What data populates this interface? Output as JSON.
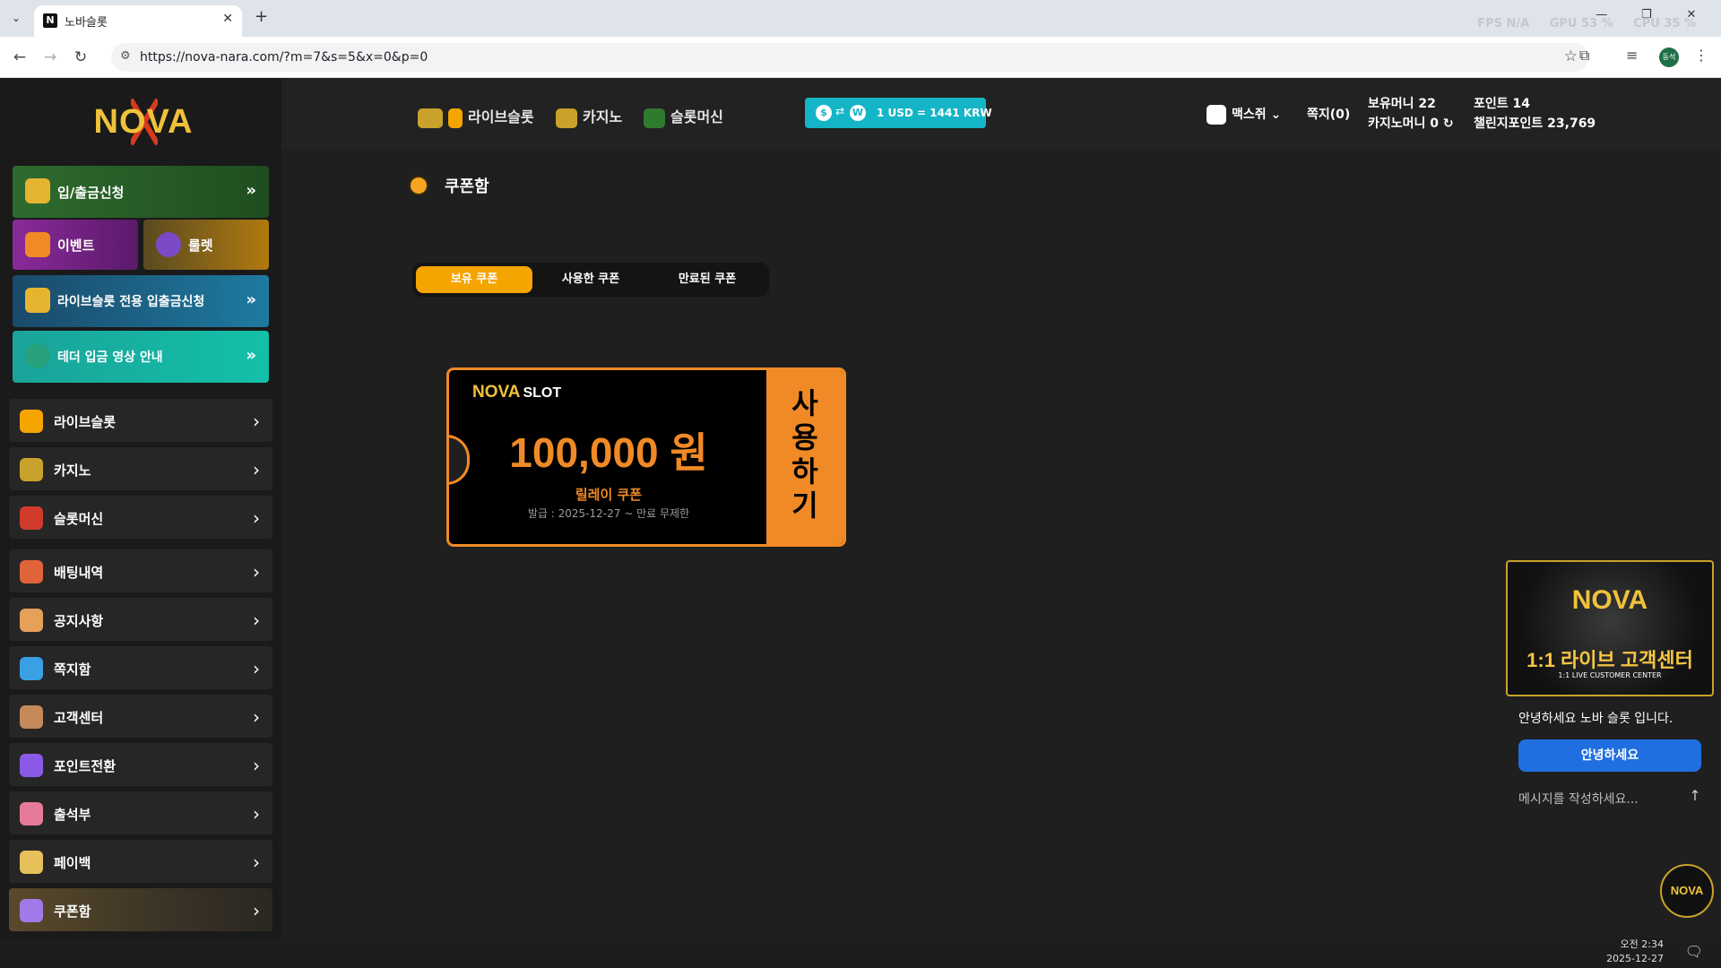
{
  "browser": {
    "tab_title": "노바슬롯",
    "tab_favicon": "N",
    "url": "https://nova-nara.com/?m=7&s=5&x=0&p=0",
    "perf": {
      "fps": "FPS  N/A",
      "gpu": "GPU  53 %",
      "cpu": "CPU  35 %"
    },
    "profile_initial": "동석"
  },
  "site": {
    "logo": "NOVA",
    "side_buttons": {
      "deposit": "입/출금신청",
      "event": "이벤트",
      "roulette": "룰렛",
      "liveslot_deposit": "라이브슬롯 전용 입출금신청",
      "tether_guide": "테더 입금 영상 안내"
    },
    "menu": [
      {
        "label": "라이브슬롯",
        "icon": "liveslot-icon",
        "color": "#f6a400"
      },
      {
        "label": "카지노",
        "icon": "casino-icon",
        "color": "#c9a22b"
      },
      {
        "label": "슬롯머신",
        "icon": "slot-machine-icon",
        "color": "#d03b2b"
      },
      {
        "label": "배팅내역",
        "icon": "clipboard-icon",
        "color": "#e0633a"
      },
      {
        "label": "공지사항",
        "icon": "megaphone-icon",
        "color": "#e6a05a"
      },
      {
        "label": "쪽지함",
        "icon": "chat-bubble-icon",
        "color": "#3aa0e6"
      },
      {
        "label": "고객센터",
        "icon": "support-agent-icon",
        "color": "#c48a5a"
      },
      {
        "label": "포인트전환",
        "icon": "exchange-icon",
        "color": "#8a5ae6"
      },
      {
        "label": "출석부",
        "icon": "calendar-icon",
        "color": "#e67a9a"
      },
      {
        "label": "페이백",
        "icon": "coin-icon",
        "color": "#e6c05a"
      },
      {
        "label": "쿠폰함",
        "icon": "ticket-icon",
        "color": "#a07ae6"
      }
    ],
    "topnav": {
      "liveslot": "라이브슬롯",
      "casino": "카지노",
      "slot": "슬롯머신",
      "rate_text": "1 USD = 1441 KRW",
      "rate_from": "$",
      "rate_to": "W",
      "username": "맥스쥐",
      "messages": "쪽지(0)",
      "balance": "보유머니 22",
      "casino_money": "카지노머니 0",
      "points": "포인트 14",
      "challenge_points": "챌린지포인트 23,769"
    },
    "page_title": "쿠폰함",
    "coupon_tabs": [
      "보유 쿠폰",
      "사용한 쿠폰",
      "만료된 쿠폰"
    ],
    "coupon": {
      "brand": "NOVA",
      "brand_suffix": "SLOT",
      "amount": "100,000 원",
      "name": "릴레이 쿠폰",
      "issued": "발급 : 2025-12-27 ~ 만료 무제한",
      "use_label": "사용하기"
    },
    "chat": {
      "banner_logo": "NOVA",
      "banner_title": "1:1 라이브 고객센터",
      "banner_sub": "1:1 LIVE CUSTOMER CENTER",
      "greeting": "안녕하세요 노바 슬롯 입니다.",
      "quick_reply": "안녕하세요",
      "input_placeholder": "메시지를 작성하세요...",
      "fab_logo": "NOVA"
    }
  },
  "taskbar": {
    "time": "오전 2:34",
    "date": "2025-12-27"
  },
  "colors": {
    "accent": "#f6a400",
    "coupon": "#f08a26",
    "rate": "#14b5c7",
    "chat_btn": "#1f6fe0"
  }
}
